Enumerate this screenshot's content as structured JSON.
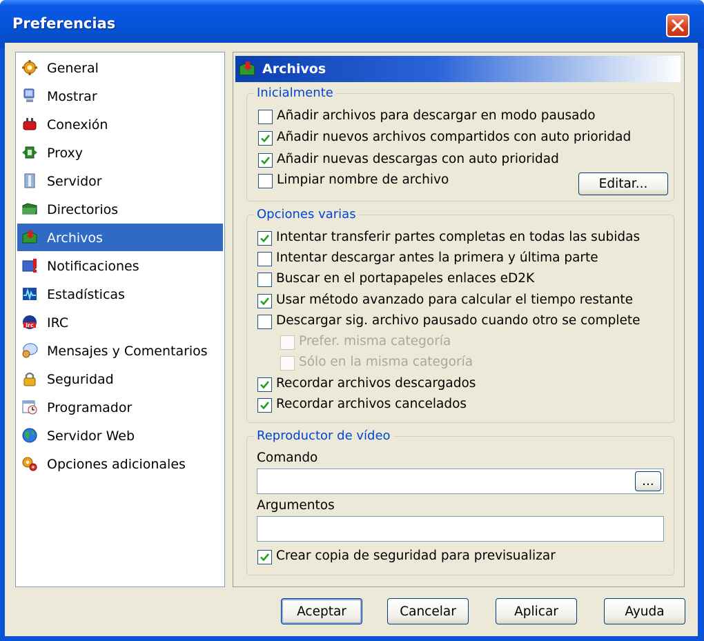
{
  "window": {
    "title": "Preferencias"
  },
  "nav": {
    "items": [
      {
        "label": "General",
        "icon": "gear-icon",
        "selected": false
      },
      {
        "label": "Mostrar",
        "icon": "monitor-icon",
        "selected": false
      },
      {
        "label": "Conexión",
        "icon": "plug-icon",
        "selected": false
      },
      {
        "label": "Proxy",
        "icon": "proxy-icon",
        "selected": false
      },
      {
        "label": "Servidor",
        "icon": "server-icon",
        "selected": false
      },
      {
        "label": "Directorios",
        "icon": "folder-icon",
        "selected": false
      },
      {
        "label": "Archivos",
        "icon": "files-icon",
        "selected": true
      },
      {
        "label": "Notificaciones",
        "icon": "notification-icon",
        "selected": false
      },
      {
        "label": "Estadísticas",
        "icon": "statistics-icon",
        "selected": false
      },
      {
        "label": "IRC",
        "icon": "irc-icon",
        "selected": false
      },
      {
        "label": "Mensajes y Comentarios",
        "icon": "messages-icon",
        "selected": false
      },
      {
        "label": "Seguridad",
        "icon": "lock-icon",
        "selected": false
      },
      {
        "label": "Programador",
        "icon": "calendar-icon",
        "selected": false
      },
      {
        "label": "Servidor Web",
        "icon": "globe-icon",
        "selected": false
      },
      {
        "label": "Opciones adicionales",
        "icon": "extra-options-icon",
        "selected": false
      }
    ]
  },
  "panel": {
    "title": "Archivos",
    "initially": {
      "legend": "Inicialmente",
      "options": [
        {
          "label": "Añadir archivos para descargar en modo pausado",
          "checked": false
        },
        {
          "label": "Añadir nuevos archivos compartidos con auto prioridad",
          "checked": true
        },
        {
          "label": "Añadir nuevas descargas con auto prioridad",
          "checked": true
        },
        {
          "label": "Limpiar nombre de archivo",
          "checked": false
        }
      ],
      "edit_button": "Editar..."
    },
    "misc": {
      "legend": "Opciones varias",
      "options": [
        {
          "label": "Intentar transferir partes completas en todas las subidas",
          "checked": true,
          "disabled": false
        },
        {
          "label": "Intentar descargar antes la primera y última parte",
          "checked": false,
          "disabled": false
        },
        {
          "label": "Buscar en el portapapeles enlaces eD2K",
          "checked": false,
          "disabled": false
        },
        {
          "label": "Usar método avanzado para calcular el tiempo restante",
          "checked": true,
          "disabled": false
        },
        {
          "label": "Descargar sig. archivo pausado cuando otro se complete",
          "checked": false,
          "disabled": false
        },
        {
          "label": "Prefer. misma categoría",
          "checked": false,
          "disabled": true
        },
        {
          "label": "Sólo en la misma categoría",
          "checked": false,
          "disabled": true
        },
        {
          "label": "Recordar archivos descargados",
          "checked": true,
          "disabled": false
        },
        {
          "label": "Recordar archivos cancelados",
          "checked": true,
          "disabled": false
        }
      ]
    },
    "video": {
      "legend": "Reproductor de vídeo",
      "command_label": "Comando",
      "command_value": "",
      "browse_button": "...",
      "arguments_label": "Argumentos",
      "arguments_value": "",
      "backup_option": {
        "label": "Crear copia de seguridad para previsualizar",
        "checked": true
      }
    }
  },
  "footer": {
    "ok": "Aceptar",
    "cancel": "Cancelar",
    "apply": "Aplicar",
    "help": "Ayuda"
  },
  "colors": {
    "title_bar": "#0552d8",
    "selection": "#316ac5",
    "group_legend": "#0046d5",
    "dialog_bg": "#ece9d8"
  }
}
